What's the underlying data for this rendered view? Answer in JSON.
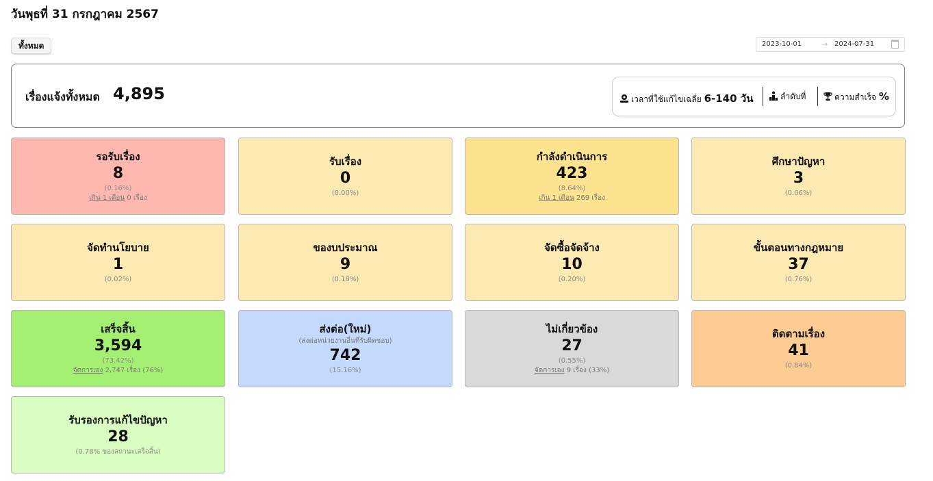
{
  "header": {
    "title": "วันพุธที่ 31 กรกฎาคม 2567"
  },
  "filter": {
    "all_label": "ทั้งหมด",
    "date_start": "2023-10-01",
    "date_end": "2024-07-31",
    "arrow": "→"
  },
  "summary": {
    "label": "เรื่องแจ้งทั้งหมด",
    "total": "4,895",
    "avg_time_label": "เวลาที่ใช้แก้ไขเฉลี่ย",
    "avg_time_value": "6-140 วัน",
    "rank_label": "ลำดับที่",
    "success_label": "ความสำเร็จ",
    "success_value": "%"
  },
  "colors": {
    "pending": "#ffb8b0",
    "light_yellow": "#fdeab2",
    "yellow": "#fde28f",
    "green": "#a5ef73",
    "blue": "#c5d9fd",
    "gray": "#d9d9d9",
    "orange": "#fccc92",
    "light_green": "#dafdc2"
  },
  "cards": [
    {
      "title": "รอรับเรื่อง",
      "value": "8",
      "pct": "(0.16%)",
      "extra_link": "เกิน 1 เดือน",
      "extra_text": " 0 เรื่อง"
    },
    {
      "title": "รับเรื่อง",
      "value": "0",
      "pct": "(0.00%)"
    },
    {
      "title": "กำลังดำเนินการ",
      "value": "423",
      "pct": "(8.64%)",
      "extra_link": "เกิน 1 เดือน",
      "extra_text": " 269 เรื่อง"
    },
    {
      "title": "ศึกษาปัญหา",
      "value": "3",
      "pct": "(0.06%)"
    },
    {
      "title": "จัดทำนโยบาย",
      "value": "1",
      "pct": "(0.02%)"
    },
    {
      "title": "ของบประมาณ",
      "value": "9",
      "pct": "(0.18%)"
    },
    {
      "title": "จัดซื้อจัดจ้าง",
      "value": "10",
      "pct": "(0.20%)"
    },
    {
      "title": "ขั้นตอนทางกฎหมาย",
      "value": "37",
      "pct": "(0.76%)"
    },
    {
      "title": "เสร็จสิ้น",
      "value": "3,594",
      "pct": "(73.42%)",
      "extra_link": "จัดการเอง",
      "extra_text": " 2,747 เรื่อง (76%)"
    },
    {
      "title": "ส่งต่อ(ใหม่)",
      "subtitle": "(ส่งต่อหน่วยงานอื่นที่รับผิดชอบ)",
      "value": "742",
      "pct": "(15.16%)"
    },
    {
      "title": "ไม่เกี่ยวข้อง",
      "value": "27",
      "pct": "(0.55%)",
      "extra_link": "จัดการเอง",
      "extra_text": " 9 เรื่อง (33%)"
    },
    {
      "title": "ติดตามเรื่อง",
      "value": "41",
      "pct": "(0.84%)"
    },
    {
      "title": "รับรองการแก้ไขปัญหา",
      "value": "28",
      "pct": "(0.78% ของสถานะเสร็จสิ้น)"
    }
  ]
}
